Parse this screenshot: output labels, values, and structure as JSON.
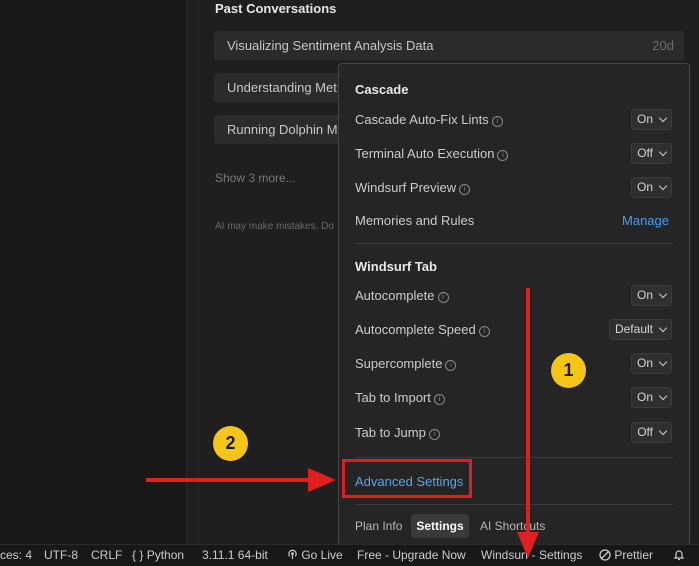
{
  "past_conversations": {
    "title": "Past Conversations",
    "items": [
      {
        "label": "Visualizing Sentiment Analysis Data",
        "age": "20d"
      },
      {
        "label": "Understanding Met",
        "age": ""
      },
      {
        "label": "Running Dolphin M",
        "age": ""
      }
    ],
    "show_more": "Show 3 more...",
    "disclaimer": "AI may make mistakes. Do"
  },
  "popup": {
    "cascade": {
      "title": "Cascade",
      "rows": [
        {
          "label": "Cascade Auto-Fix Lints",
          "value": "On"
        },
        {
          "label": "Terminal Auto Execution",
          "value": "Off"
        },
        {
          "label": "Windsurf Preview",
          "value": "On"
        }
      ],
      "memories_label": "Memories and Rules",
      "manage_label": "Manage"
    },
    "windsurf_tab": {
      "title": "Windsurf Tab",
      "rows": [
        {
          "label": "Autocomplete",
          "value": "On"
        },
        {
          "label": "Autocomplete Speed",
          "value": "Default"
        },
        {
          "label": "Supercomplete",
          "value": "On"
        },
        {
          "label": "Tab to Import",
          "value": "On"
        },
        {
          "label": "Tab to Jump",
          "value": "Off"
        }
      ]
    },
    "advanced_settings": "Advanced Settings",
    "footer_tabs": {
      "plan_info": "Plan Info",
      "settings": "Settings",
      "ai_shortcuts": "AI Shortcuts"
    }
  },
  "annotations": {
    "badge_1": "1",
    "badge_2": "2",
    "highlight_color": "#e02020",
    "badge_color": "#f5c518"
  },
  "status_bar": {
    "spaces": "ces: 4",
    "encoding": "UTF-8",
    "line_ending": "CRLF",
    "braces": "{ }",
    "language": "Python",
    "interpreter": "3.11.1 64-bit",
    "go_live": "Go Live",
    "upgrade": "Free - Upgrade Now",
    "windsurf_settings": "Windsurf - Settings",
    "prettier": "Prettier"
  }
}
